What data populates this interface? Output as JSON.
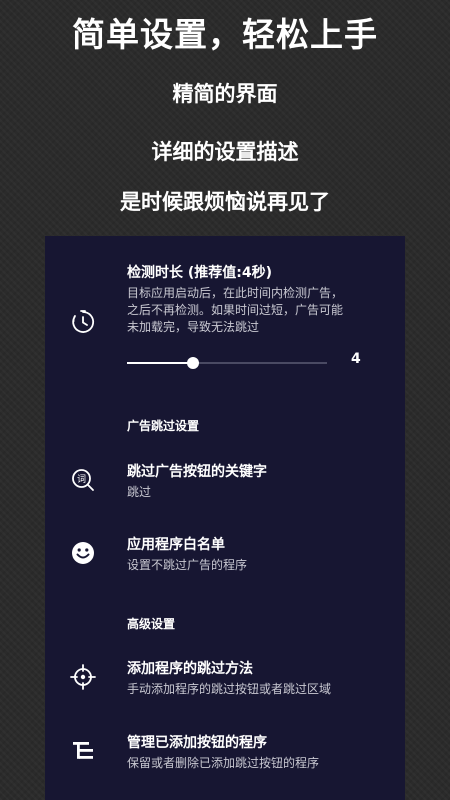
{
  "hero": {
    "title": "简单设置，轻松上手",
    "line1": "精简的界面",
    "line2": "详细的设置描述",
    "line3": "是时候跟烦恼说再见了"
  },
  "settings": {
    "detection": {
      "title": "检测时长 (推荐值:4秒)",
      "desc_lines": [
        "目标应用启动后，在此时间内检测广告，",
        "之后不再检测。如果时间过短，广告可能",
        "未加载完，导致无法跳过"
      ],
      "slider_fraction": 0.33,
      "value": "4",
      "icon": "timer-icon"
    },
    "ad_section_header": "广告跳过设置",
    "keywords": {
      "title": "跳过广告按钮的关键字",
      "subtitle": "跳过",
      "icon": "keyword-search-icon"
    },
    "whitelist": {
      "title": "应用程序白名单",
      "subtitle": "设置不跳过广告的程序",
      "icon": "smiley-icon"
    },
    "advanced_section_header": "高级设置",
    "add_method": {
      "title": "添加程序的跳过方法",
      "subtitle": "手动添加程序的跳过按钮或者跳过区域",
      "icon": "crosshair-icon"
    },
    "manage": {
      "title": "管理已添加按钮的程序",
      "subtitle": "保留或者删除已添加跳过按钮的程序",
      "icon": "list-manage-icon"
    }
  }
}
